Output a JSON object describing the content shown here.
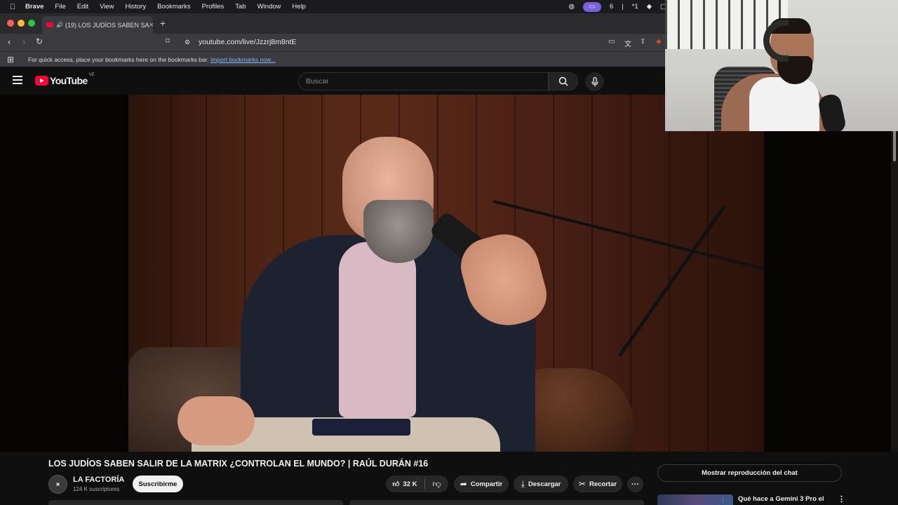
{
  "menubar": {
    "apple": "",
    "items": [
      "Brave",
      "File",
      "Edit",
      "View",
      "History",
      "Bookmarks",
      "Profiles",
      "Tab",
      "Window",
      "Help"
    ],
    "right_count": "6",
    "right_star": "*1"
  },
  "browser": {
    "tab_title": "(19) LOS JUDÍOS SABEN SA",
    "new_tab": "+",
    "url": "youtube.com/live/Jzzrj8m8ntE",
    "bookmarks_text": "For quick access, place your bookmarks here on the bookmarks bar.",
    "bookmarks_link": "Import bookmarks now..."
  },
  "youtube": {
    "logo_text": "YouTube",
    "country_code": "VE",
    "search_placeholder": "Buscar"
  },
  "video": {
    "title": "LOS JUDÍOS SABEN SALIR DE LA MATRIX ¿CONTROLAN EL MUNDO? | RAÚL DURÁN #16",
    "channel_name": "LA FACTORÍA",
    "subscribers": "124 K suscriptores",
    "subscribe_label": "Suscribirme",
    "likes": "32 K",
    "share_label": "Compartir",
    "download_label": "Descargar",
    "clip_label": "Recortar",
    "more_label": "···"
  },
  "sidebar": {
    "chat_replay_label": "Mostrar reproducción del chat",
    "rec_title": "Qué hace a Gemini 3 Pro el"
  }
}
